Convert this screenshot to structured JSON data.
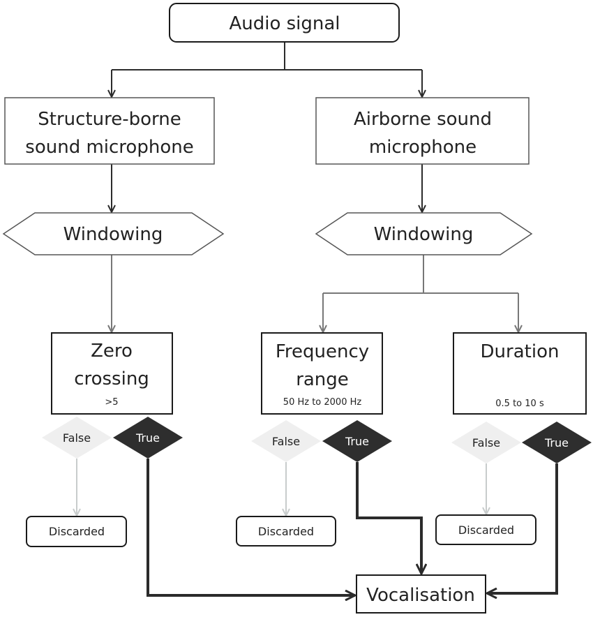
{
  "nodes": {
    "audio_signal": "Audio signal",
    "structure_borne": [
      "Structure-borne",
      "sound microphone"
    ],
    "airborne": [
      "Airborne sound",
      "microphone"
    ],
    "windowing_left": "Windowing",
    "windowing_right": "Windowing",
    "zero_crossing": {
      "title": [
        "Zero",
        "crossing"
      ],
      "condition": ">5"
    },
    "frequency_range": {
      "title": [
        "Frequency",
        "range"
      ],
      "condition": "50 Hz to 2000 Hz"
    },
    "duration": {
      "title": [
        "Duration"
      ],
      "condition": "0.5 to 10 s"
    },
    "false_label": "False",
    "true_label": "True",
    "discarded": "Discarded",
    "vocalisation": "Vocalisation"
  },
  "colors": {
    "line_dark": "#2b2b2b",
    "line_gray": "#777777",
    "false_arrow": "#c8cccc",
    "false_fill": "#efefef",
    "true_fill": "#2e2e2e"
  }
}
